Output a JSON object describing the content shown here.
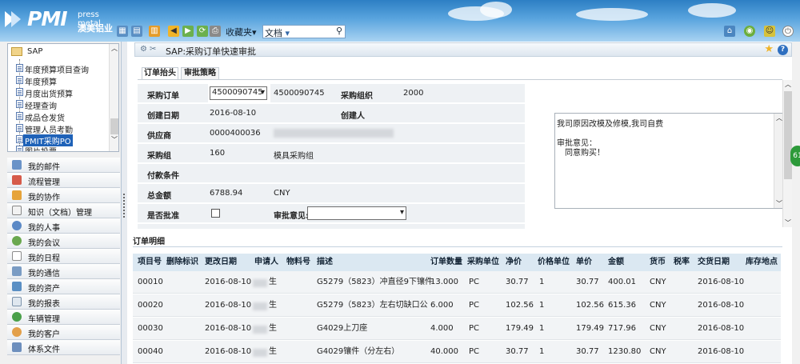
{
  "brand": {
    "logo_text": "PMI",
    "english": "press metal",
    "chinese": "澳美铝业"
  },
  "toolbar": {
    "favorites_label": "收藏夹",
    "search_type": "文档"
  },
  "sidebar": {
    "root": "SAP",
    "items": [
      "年度预算项目查询",
      "年度预算",
      "月度出货预算",
      "经理查询",
      "成品仓发货",
      "管理人员考勤",
      "PMIT采购PO",
      "图片投票"
    ],
    "selected": "PMIT采购PO",
    "menu": [
      "我的邮件",
      "流程管理",
      "我的协作",
      "知识（文档）管理",
      "我的人事",
      "我的会议",
      "我的日程",
      "我的通信",
      "我的资产",
      "我的报表",
      "车辆管理",
      "我的客户",
      "体系文件"
    ]
  },
  "page": {
    "title": "SAP:采购订单快速审批"
  },
  "tabs": [
    "订单抬头",
    "审批策略"
  ],
  "form": {
    "po_label": "采购订单",
    "po_select": "4500090745",
    "po_value": "4500090745",
    "org_label": "采购组织",
    "org_value": "2000",
    "created_label": "创建日期",
    "created_value": "2016-08-10",
    "creator_label": "创建人",
    "supplier_label": "供应商",
    "supplier_value": "0000400036",
    "group_label": "采购组",
    "group_value": "160",
    "group_name": "模具采购组",
    "payment_label": "付款条件",
    "total_label": "总金额",
    "total_value": "6788.94",
    "currency": "CNY",
    "batch_label": "是否批准",
    "opinion_label": "审批意见:"
  },
  "approval_note": {
    "line1": "我司原因改模及修模,我司自费",
    "line2": "审批意见：",
    "line3": "同意购买！"
  },
  "detail": {
    "title": "订单明细",
    "headers": [
      "项目号",
      "删除标识",
      "更改日期",
      "申请人",
      "物料号",
      "描述",
      "订单数量",
      "采购单位",
      "净价",
      "价格单位",
      "单价",
      "金额",
      "货币",
      "税率",
      "交货日期",
      "库存地点"
    ],
    "rows": [
      [
        "00010",
        "",
        "2016-08-10",
        "生",
        "",
        "G5279（5823）冲直径9下镶件",
        "13.000",
        "PC",
        "30.77",
        "1",
        "30.77",
        "400.01",
        "CNY",
        "",
        "2016-08-10",
        ""
      ],
      [
        "00020",
        "",
        "2016-08-10",
        "生",
        "",
        "G5279（5823）左右切缺口公",
        "6.000",
        "PC",
        "102.56",
        "1",
        "102.56",
        "615.36",
        "CNY",
        "",
        "2016-08-10",
        ""
      ],
      [
        "00030",
        "",
        "2016-08-10",
        "生",
        "",
        "G4029上刀座",
        "4.000",
        "PC",
        "179.49",
        "1",
        "179.49",
        "717.96",
        "CNY",
        "",
        "2016-08-10",
        ""
      ],
      [
        "00040",
        "",
        "2016-08-10",
        "生",
        "",
        "G4029镶件（分左右）",
        "40.000",
        "PC",
        "30.77",
        "1",
        "30.77",
        "1230.80",
        "CNY",
        "",
        "2016-08-10",
        ""
      ]
    ]
  },
  "side_bubble": "61",
  "colors": {
    "header_top": "#2d7fc4",
    "accent": "#1f62b8",
    "table_header": "#dbe8f2"
  }
}
